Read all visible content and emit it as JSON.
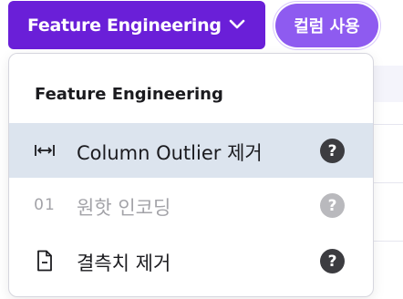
{
  "toolbar": {
    "feature_button_label": "Feature Engineering",
    "feature_button_icon": "chevron-down-icon",
    "column_button_label": "컬럼 사용"
  },
  "menu": {
    "heading": "Feature Engineering",
    "items": [
      {
        "label": "Column Outlier 제거",
        "icon": "column-width-icon",
        "state": "selected",
        "help": "?"
      },
      {
        "label": "원핫 인코딩",
        "icon_text": "01",
        "state": "disabled",
        "help": "?"
      },
      {
        "label": "결측치 제거",
        "icon": "document-minus-icon",
        "state": "enabled",
        "help": "?"
      }
    ]
  },
  "colors": {
    "primary": "#6a1fd8",
    "pill": "#8e5bf0",
    "selected_row": "#dce4ee",
    "help_icon": "#3c3c40",
    "disabled": "#a3a3a8"
  }
}
